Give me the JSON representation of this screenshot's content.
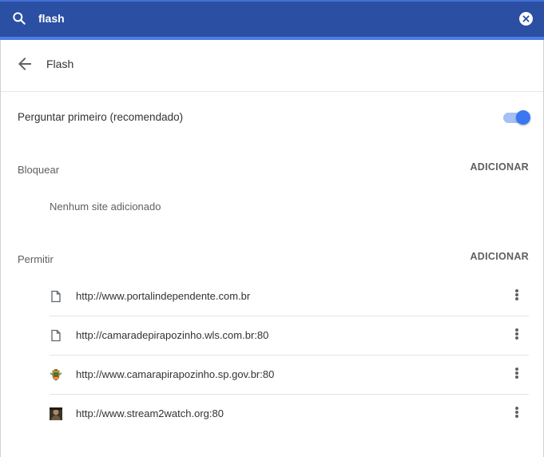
{
  "search": {
    "value": "flash"
  },
  "header": {
    "title": "Flash"
  },
  "ask_first": {
    "label": "Perguntar primeiro (recomendado)",
    "enabled": true,
    "accent": "#3a78f2"
  },
  "block": {
    "title": "Bloquear",
    "add_label": "ADICIONAR",
    "empty": "Nenhum site adicionado"
  },
  "allow": {
    "title": "Permitir",
    "add_label": "ADICIONAR",
    "sites": [
      {
        "url": "http://www.portalindependente.com.br",
        "icon": "document-icon"
      },
      {
        "url": "http://camaradepirapozinho.wls.com.br:80",
        "icon": "document-icon"
      },
      {
        "url": "http://www.camarapirapozinho.sp.gov.br:80",
        "icon": "coat-of-arms-favicon"
      },
      {
        "url": "http://www.stream2watch.org:80",
        "icon": "photo-favicon"
      }
    ]
  },
  "colors": {
    "search_bar": "#2a4fa3",
    "strip": "#4a7de6"
  }
}
